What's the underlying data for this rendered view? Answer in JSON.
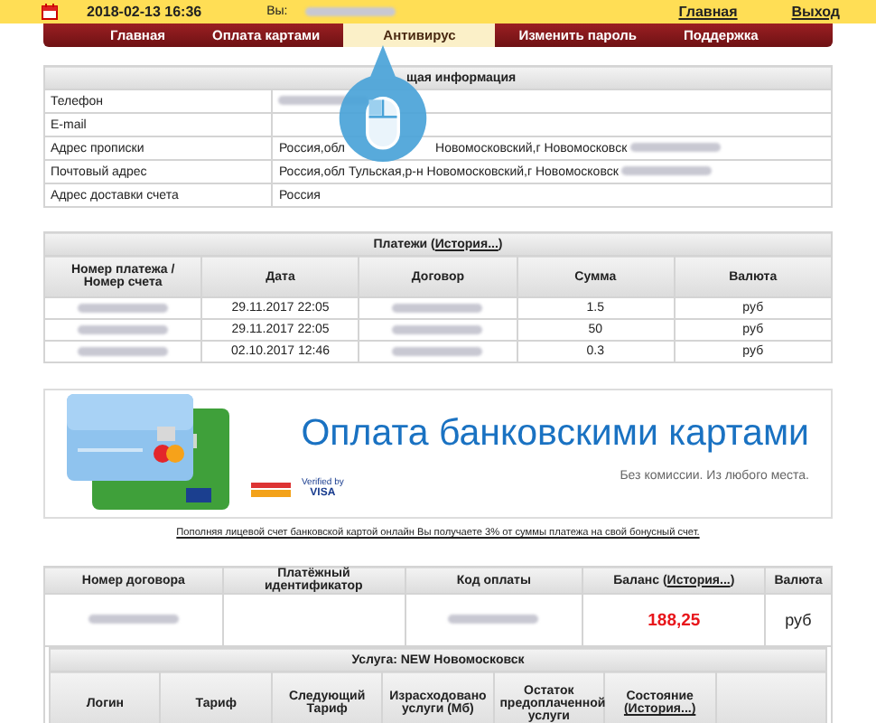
{
  "top_bar": {
    "datetime": "2018-02-13 16:36",
    "user_label": "Вы:",
    "links": [
      "Главная",
      "Выход"
    ]
  },
  "nav": [
    {
      "label": "Главная",
      "selected": false
    },
    {
      "label": "Оплата картами",
      "selected": false
    },
    {
      "label": "Антивирус",
      "selected": true
    },
    {
      "label": "Изменить пароль",
      "selected": false
    },
    {
      "label": "Поддержка",
      "selected": false
    }
  ],
  "info": {
    "title": "щая информация",
    "rows": [
      {
        "label": "Телефон",
        "value": [
          {
            "kind": "blurred"
          }
        ]
      },
      {
        "label": "E-mail",
        "value": []
      },
      {
        "label": "Адрес прописки",
        "value": [
          {
            "kind": "text",
            "text": "Россия,обл"
          },
          {
            "kind": "gap"
          },
          {
            "kind": "text",
            "text": "Новомосковский,г Новомосковск"
          },
          {
            "kind": "blurred"
          }
        ]
      },
      {
        "label": "Почтовый адрес",
        "value": [
          {
            "kind": "text",
            "text": "Россия,обл Тульская,р-н Новомосковский,г Новомосковск"
          },
          {
            "kind": "blurred"
          }
        ]
      },
      {
        "label": "Адрес доставки счета",
        "value": [
          {
            "kind": "text",
            "text": "Россия"
          }
        ]
      }
    ]
  },
  "payments": {
    "title": "Платежи (",
    "link": "История...",
    "title_end": ")",
    "columns": [
      "Номер платежа / Номер счета",
      "Дата",
      "Договор",
      "Сумма",
      "Валюта"
    ],
    "rows": [
      [
        {
          "kind": "blurred"
        },
        {
          "kind": "text",
          "text": "29.11.2017 22:05"
        },
        {
          "kind": "blurred"
        },
        {
          "kind": "text",
          "text": "1.5"
        },
        {
          "kind": "text",
          "text": "руб"
        }
      ],
      [
        {
          "kind": "blurred"
        },
        {
          "kind": "text",
          "text": "29.11.2017 22:05"
        },
        {
          "kind": "blurred"
        },
        {
          "kind": "text",
          "text": "50"
        },
        {
          "kind": "text",
          "text": "руб"
        }
      ],
      [
        {
          "kind": "blurred"
        },
        {
          "kind": "text",
          "text": "02.10.2017 12:46"
        },
        {
          "kind": "blurred"
        },
        {
          "kind": "text",
          "text": "0.3"
        },
        {
          "kind": "text",
          "text": "руб"
        }
      ]
    ]
  },
  "banner": {
    "title": "Оплата банковскими картами",
    "subtitle": "Без комиссии. Из любого места.",
    "verified": "Verified by",
    "visa": "VISA"
  },
  "bonus_link": "Пополняя лицевой счет банковской картой онлайн Вы получаете 3% от суммы платежа на свой бонусный счет.",
  "contract": {
    "columns": [
      {
        "label": "Номер договора"
      },
      {
        "label": "Платёжный идентификатор"
      },
      {
        "label": "Код оплаты"
      },
      {
        "label": "Баланс (",
        "link": "История...",
        "after": ")"
      },
      {
        "label": "Валюта"
      }
    ],
    "row": [
      {
        "kind": "blurred"
      },
      {
        "kind": "blank"
      },
      {
        "kind": "blurred"
      },
      {
        "kind": "balance",
        "text": "188,25"
      },
      {
        "kind": "text",
        "text": "руб"
      }
    ]
  },
  "service": {
    "title": "Услуга: NEW Новомосковск",
    "columns": [
      {
        "label": "Логин"
      },
      {
        "label": "Тариф"
      },
      {
        "label": "Следующий Тариф"
      },
      {
        "label": "Израсходовано услуги (Мб)"
      },
      {
        "label": "Остаток предоплаченной услуги"
      },
      {
        "label": "Состояние",
        "link": "(История...)"
      }
    ]
  }
}
